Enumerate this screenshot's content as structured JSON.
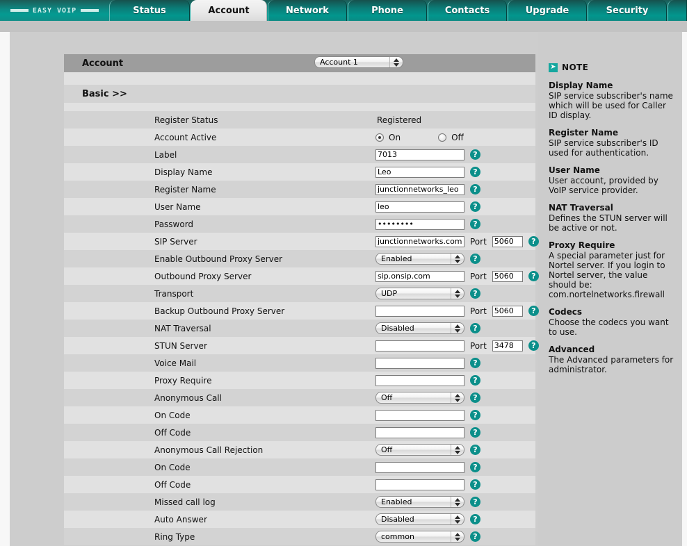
{
  "brand": {
    "logo_text": "EASY VOIP"
  },
  "tabs": [
    {
      "label": "Status",
      "active": false
    },
    {
      "label": "Account",
      "active": true
    },
    {
      "label": "Network",
      "active": false
    },
    {
      "label": "Phone",
      "active": false
    },
    {
      "label": "Contacts",
      "active": false
    },
    {
      "label": "Upgrade",
      "active": false
    },
    {
      "label": "Security",
      "active": false
    }
  ],
  "panel": {
    "title": "Account",
    "account_select": "Account 1",
    "section_title": "Basic >>"
  },
  "help_icon": "question-mark-icon",
  "port_label": "Port",
  "rows": [
    {
      "label": "Register Status",
      "type": "static",
      "value": "Registered",
      "help": false
    },
    {
      "label": "Account Active",
      "type": "radio",
      "on_label": "On",
      "off_label": "Off",
      "selected": "On",
      "help": false
    },
    {
      "label": "Label",
      "type": "text",
      "value": "7013",
      "help": true
    },
    {
      "label": "Display Name",
      "type": "text",
      "value": "Leo",
      "help": true
    },
    {
      "label": "Register Name",
      "type": "text",
      "value": "junctionnetworks_leo",
      "help": true
    },
    {
      "label": "User Name",
      "type": "text",
      "value": "leo",
      "help": true
    },
    {
      "label": "Password",
      "type": "password",
      "value": "••••••••",
      "help": true
    },
    {
      "label": "SIP Server",
      "type": "text-port",
      "value": "junctionnetworks.com",
      "port": "5060",
      "help": true
    },
    {
      "label": "Enable Outbound Proxy Server",
      "type": "select",
      "value": "Enabled",
      "help": true
    },
    {
      "label": "Outbound Proxy Server",
      "type": "text-port",
      "value": "sip.onsip.com",
      "port": "5060",
      "help": true
    },
    {
      "label": "Transport",
      "type": "select",
      "value": "UDP",
      "help": true
    },
    {
      "label": "Backup Outbound Proxy Server",
      "type": "text-port",
      "value": "",
      "port": "5060",
      "help": true
    },
    {
      "label": "NAT Traversal",
      "type": "select",
      "value": "Disabled",
      "help": true
    },
    {
      "label": "STUN Server",
      "type": "text-port",
      "value": "",
      "port": "3478",
      "help": true
    },
    {
      "label": "Voice Mail",
      "type": "text",
      "value": "",
      "help": true
    },
    {
      "label": "Proxy Require",
      "type": "text",
      "value": "",
      "help": true
    },
    {
      "label": "Anonymous Call",
      "type": "select",
      "value": "Off",
      "help": true
    },
    {
      "label": "On Code",
      "type": "text",
      "value": "",
      "help": true
    },
    {
      "label": "Off Code",
      "type": "text",
      "value": "",
      "help": true
    },
    {
      "label": "Anonymous Call Rejection",
      "type": "select",
      "value": "Off",
      "help": true
    },
    {
      "label": "On Code",
      "type": "text",
      "value": "",
      "help": true
    },
    {
      "label": "Off Code",
      "type": "text",
      "value": "",
      "help": true
    },
    {
      "label": "Missed call log",
      "type": "select",
      "value": "Enabled",
      "help": true
    },
    {
      "label": "Auto Answer",
      "type": "select",
      "value": "Disabled",
      "help": true
    },
    {
      "label": "Ring Type",
      "type": "select",
      "value": "common",
      "help": true
    }
  ],
  "note": {
    "heading": "NOTE",
    "items": [
      {
        "title": "Display Name",
        "body": "SIP service subscriber's name which will be used for Caller ID display."
      },
      {
        "title": "Register Name",
        "body": "SIP service subscriber's ID used for authentication."
      },
      {
        "title": "User Name",
        "body": "User account, provided by VoIP service provider."
      },
      {
        "title": "NAT Traversal",
        "body": "Defines the STUN server will be active or not."
      },
      {
        "title": "Proxy Require",
        "body": "A special parameter just for Nortel server. If you login to Nortel server, the value should be: com.nortelnetworks.firewall"
      },
      {
        "title": "Codecs",
        "body": "Choose the codecs you want to use."
      },
      {
        "title": "Advanced",
        "body": "The Advanced parameters for administrator."
      }
    ]
  },
  "colors": {
    "teal": "#0b8f8a",
    "row_odd": "#d3d3d3",
    "row_even": "#e1e1e1",
    "panel_head": "#9d9d9d",
    "page_bg": "#cdcdcd"
  }
}
